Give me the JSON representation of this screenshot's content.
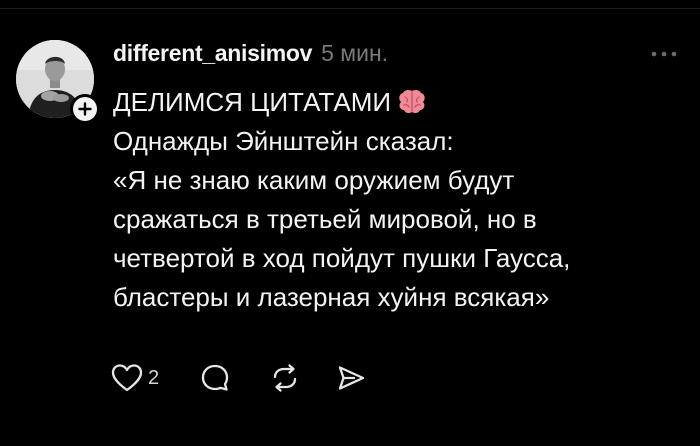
{
  "post": {
    "author": {
      "username": "different_anisimov",
      "avatar_icon": "person-photo",
      "follow_icon": "plus-icon"
    },
    "timestamp": "5 мин.",
    "more_icon": "more-horizontal-icon",
    "lines": [
      "ДЕЛИМСЯ ЦИТАТАМИ",
      "Однажды Эйнштейн сказал:",
      "«Я не знаю каким оружием будут",
      "сражаться в третьей мировой, но в",
      "четвертой в ход пойдут пушки Гаусса,",
      "бластеры и лазерная хуйня всякая»"
    ],
    "title_emoji": "brain-icon"
  },
  "actions": {
    "like": {
      "icon": "heart-icon",
      "count": "2"
    },
    "comment": {
      "icon": "comment-icon"
    },
    "repost": {
      "icon": "repost-icon"
    },
    "share": {
      "icon": "send-icon"
    }
  },
  "colors": {
    "background": "#000000",
    "text": "#f3f3f3",
    "muted": "#7a7a7a",
    "brain": "#f08a96"
  }
}
